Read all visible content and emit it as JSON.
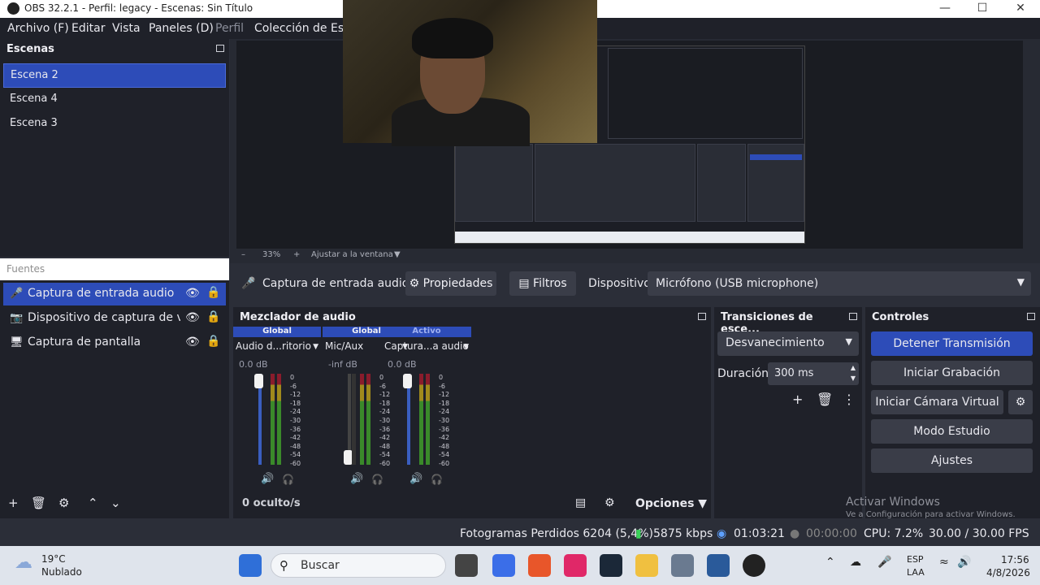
{
  "window": {
    "title": "OBS 32.2.1 - Perfil: legacy - Escenas: Sin Título"
  },
  "menu": {
    "items": [
      "Archivo (F)",
      "Editar",
      "Vista",
      "Paneles (D)",
      "Perfil",
      "Colección de Escen"
    ]
  },
  "preview": {
    "zoom": "33%",
    "fit": "Ajustar a la ventana"
  },
  "scenes": {
    "title": "Escenas",
    "items": [
      "Escena 2",
      "Escena 4",
      "Escena 3"
    ],
    "selected": "Escena 2"
  },
  "sources": {
    "title": "Fuentes",
    "items": [
      "Captura de entrada audio",
      "Dispositivo de captura de video",
      "Captura de pantalla"
    ]
  },
  "source_bar": {
    "name": "Captura de entrada audio",
    "properties": "Propiedades",
    "filters": "Filtros",
    "device_label": "Dispositivo",
    "device_value": "Micrófono (USB microphone)"
  },
  "mixer": {
    "title": "Mezclador de audio",
    "channels": [
      {
        "tag": "Global",
        "name": "Audio d...ritorio",
        "db": "0.0 dB",
        "level": 1.0
      },
      {
        "tag": "Global",
        "name": "Mic/Aux",
        "db": "-inf dB",
        "level": 0.0
      },
      {
        "tag": "Activo",
        "name": "Captura...a audio",
        "db": "0.0 dB",
        "level": 1.0
      }
    ],
    "scale": [
      "0",
      "-6",
      "-12",
      "-18",
      "-24",
      "-30",
      "-36",
      "-42",
      "-48",
      "-54",
      "-60"
    ],
    "hidden": "0 oculto/s",
    "options": "Opciones"
  },
  "transitions": {
    "title": "Transiciones de esce...",
    "type": "Desvanecimiento",
    "duration_label": "Duración",
    "duration": "300 ms"
  },
  "controls": {
    "title": "Controles",
    "stop_stream": "Detener Transmisión",
    "start_record": "Iniciar Grabación",
    "virtual_cam": "Iniciar Cámara Virtual",
    "studio": "Modo Estudio",
    "settings": "Ajustes"
  },
  "status": {
    "dropped": "Fotogramas Perdidos 6204 (5,4%)",
    "bitrate": "5875 kbps",
    "stream_time": "01:03:21",
    "rec_time": "00:00:00",
    "cpu": "CPU: 7.2%",
    "fps": "30.00 / 30.00 FPS"
  },
  "watermark": {
    "line1": "Activar Windows",
    "line2": "Ve a Configuración para activar Windows."
  },
  "taskbar": {
    "weather_temp": "19°C",
    "weather_desc": "Nublado",
    "search": "Buscar",
    "lang1": "ESP",
    "lang2": "LAA",
    "time": "17:56",
    "date": "4/8/2026"
  }
}
